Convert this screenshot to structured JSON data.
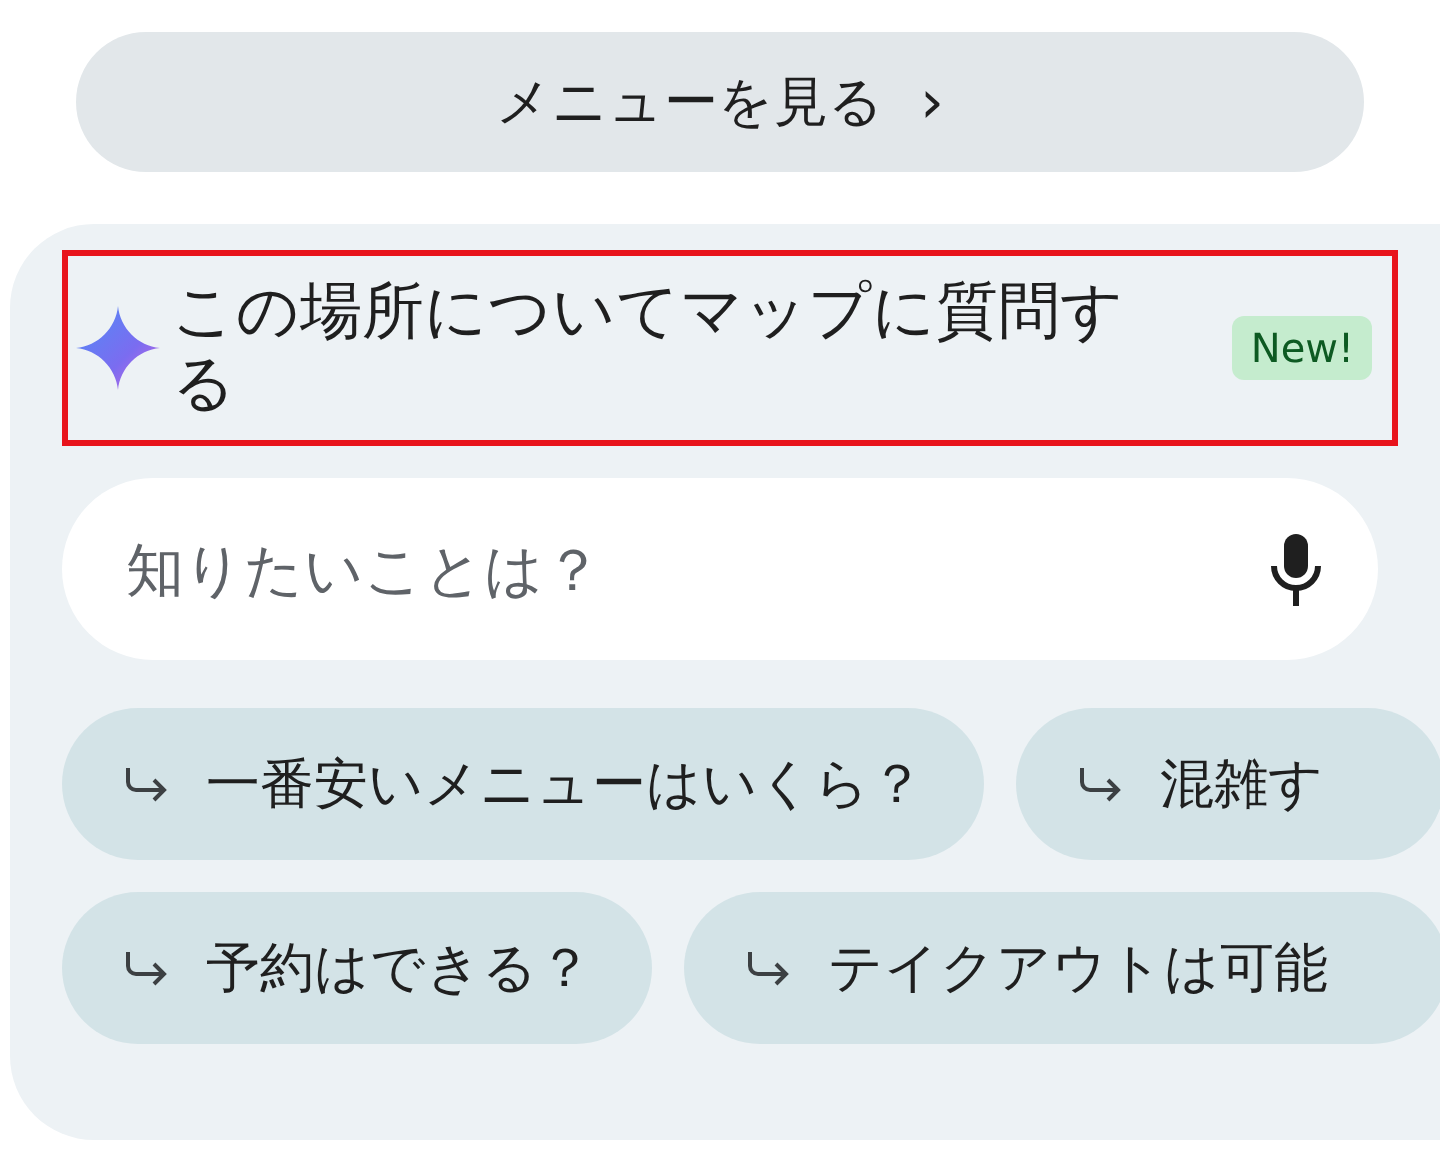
{
  "menu_button": {
    "label": "メニューを見る",
    "chevron": "›"
  },
  "ask_panel": {
    "title": "この場所についてマップに質問する",
    "badge": "New!",
    "highlighted": true,
    "search": {
      "placeholder": "知りたいことは？"
    },
    "suggestion_rows": [
      [
        {
          "label": "一番安いメニューはいくら？"
        },
        {
          "label": "混雑す"
        }
      ],
      [
        {
          "label": "予約はできる？"
        },
        {
          "label": "テイクアウトは可能"
        }
      ]
    ]
  }
}
